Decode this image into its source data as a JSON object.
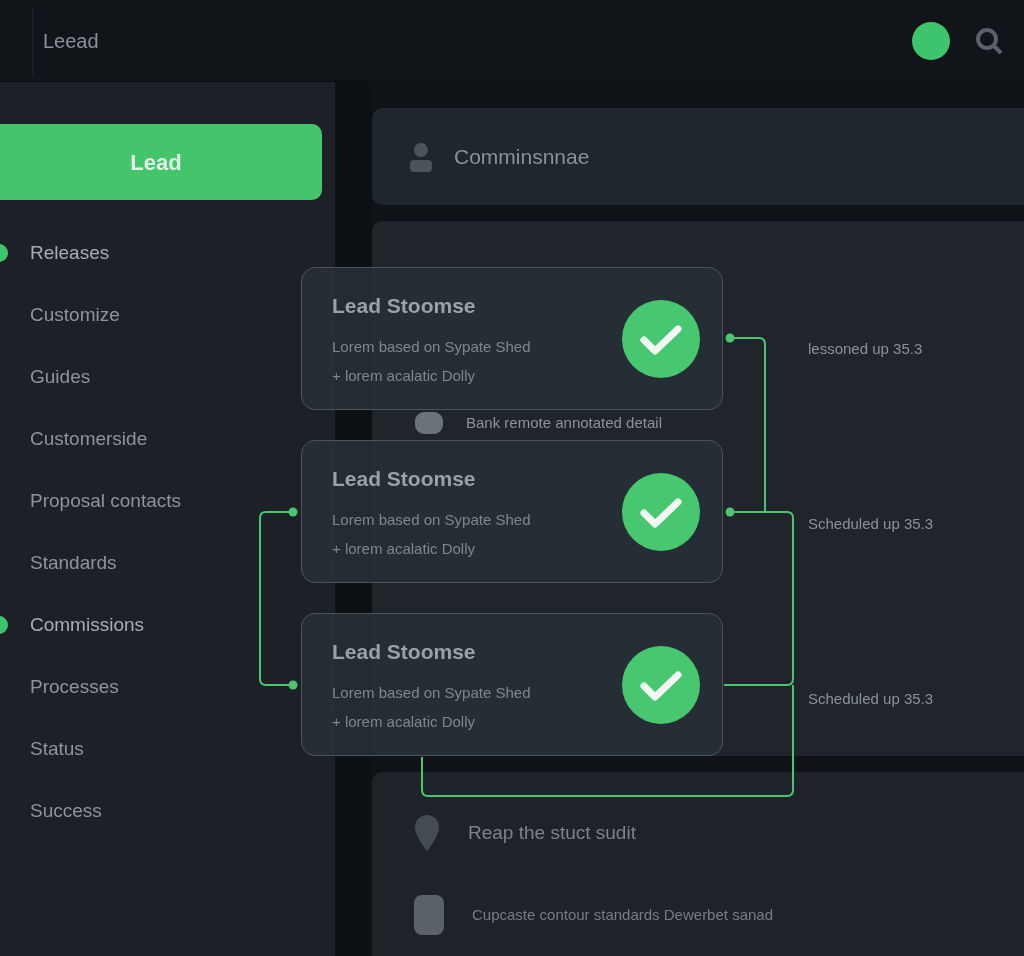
{
  "top_bar": {
    "title": "Leead"
  },
  "sidebar": {
    "primary_button": "Lead",
    "items": [
      {
        "label": "Releases",
        "highlighted": true
      },
      {
        "label": "Customize",
        "highlighted": false
      },
      {
        "label": "Guides",
        "highlighted": false
      },
      {
        "label": "Customerside",
        "highlighted": false
      },
      {
        "label": "Proposal contacts",
        "highlighted": false
      },
      {
        "label": "Standards",
        "highlighted": false
      },
      {
        "label": "Commissions",
        "highlighted": true
      },
      {
        "label": "Processes",
        "highlighted": false
      },
      {
        "label": "Status",
        "highlighted": false
      },
      {
        "label": "Success",
        "highlighted": false
      }
    ]
  },
  "main": {
    "header_title": "Comminsnnae",
    "rows": [
      {
        "kind": "blank"
      },
      {
        "kind": "tail",
        "text": "lessoned up 35.3"
      },
      {
        "kind": "item",
        "text": "Bank remote annotated detail"
      },
      {
        "kind": "tail",
        "text": "Scheduled up 35.3"
      },
      {
        "kind": "blank"
      },
      {
        "kind": "tail",
        "text": "Scheduled up 35.3"
      }
    ],
    "footer_rows": [
      {
        "kind": "pin",
        "text": "Reap the stuct sudit"
      },
      {
        "kind": "doc",
        "text": "Cupcaste contour standards Dewerbet sanad"
      }
    ]
  },
  "flow_cards": [
    {
      "title": "Lead Stoomse",
      "lines": [
        "Lorem based on Sypate Shed",
        "+ lorem acalatic Dolly"
      ],
      "checked": true
    },
    {
      "title": "Lead Stoomse",
      "lines": [
        "Lorem based on Sypate Shed",
        "+ lorem acalatic Dolly"
      ],
      "checked": true
    },
    {
      "title": "Lead Stoomse",
      "lines": [
        "Lorem based on Sypate Shed",
        "+ lorem acalatic Dolly"
      ],
      "checked": true
    }
  ]
}
